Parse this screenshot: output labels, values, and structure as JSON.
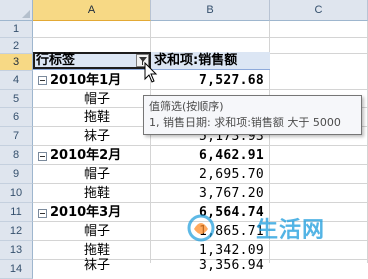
{
  "columns": [
    "A",
    "B",
    "C"
  ],
  "rows": [
    "1",
    "2",
    "3",
    "4",
    "5",
    "6",
    "7",
    "8",
    "9",
    "10",
    "11",
    "12",
    "13",
    "14"
  ],
  "header": {
    "row_label": "行标签",
    "value_label": "求和项:销售额"
  },
  "pivot_rows": [
    {
      "label": "2010年1月",
      "value": "7,527.68"
    },
    {
      "label": "帽子",
      "value": ""
    },
    {
      "label": "拖鞋",
      "value": ""
    },
    {
      "label": "袜子",
      "value": "5,173.93"
    },
    {
      "label": "2010年2月",
      "value": "6,462.91"
    },
    {
      "label": "帽子",
      "value": "2,695.70"
    },
    {
      "label": "拖鞋",
      "value": "3,767.20"
    },
    {
      "label": "2010年3月",
      "value": "6,564.74"
    },
    {
      "label": "帽子",
      "value": "1,865.71"
    },
    {
      "label": "拖鞋",
      "value": "1,342.09"
    },
    {
      "label": "袜子",
      "value": "3,356.94"
    }
  ],
  "tooltip": {
    "title": "值筛选(按顺序)",
    "line": "1, 销售日期: 求和项:销售额 大于 5000"
  },
  "watermark": {
    "text": "生活网"
  },
  "colors": {
    "header_bg": "#dfe5ee",
    "selected_header": "#f7d985",
    "pivot_header_bg": "#dce6f4",
    "watermark": "#199bdc"
  }
}
